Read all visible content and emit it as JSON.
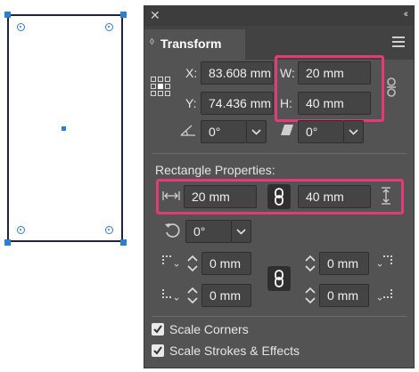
{
  "panel": {
    "close_glyph": "✕",
    "collapse_glyph": "‹‹",
    "tab_label": "Transform",
    "menu_icon": "hamburger-icon"
  },
  "position": {
    "x_label": "X:",
    "x_value": "83.608 mm",
    "y_label": "Y:",
    "y_value": "74.436 mm",
    "w_label": "W:",
    "w_value": "20 mm",
    "h_label": "H:",
    "h_value": "40 mm",
    "rotate_value": "0°",
    "shear_value": "0°"
  },
  "rectangle": {
    "heading": "Rectangle Properties:",
    "width_value": "20 mm",
    "height_value": "40 mm",
    "rotation_value": "0°",
    "corner_tl": "0 mm",
    "corner_tr": "0 mm",
    "corner_bl": "0 mm",
    "corner_br": "0 mm"
  },
  "options": {
    "scale_corners": "Scale Corners",
    "scale_corners_checked": true,
    "scale_strokes": "Scale Strokes & Effects",
    "scale_strokes_checked": true
  },
  "colors": {
    "highlight": "#e23b78",
    "selection": "#2b7fd6",
    "panel_bg": "#535353"
  }
}
